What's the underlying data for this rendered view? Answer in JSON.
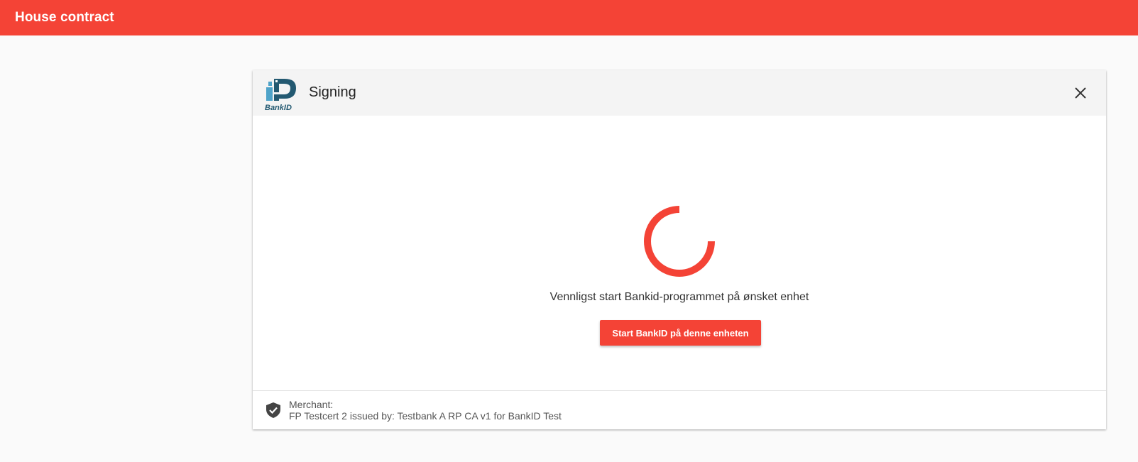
{
  "app": {
    "title": "House contract",
    "accent_color": "#f44336"
  },
  "dialog": {
    "logo": {
      "icon": "bankid-logo-icon",
      "text": "BankID"
    },
    "title": "Signing",
    "close_icon": "close-icon",
    "status_text": "Vennligst start Bankid-programmet på ønsket enhet",
    "spinner_icon": "loading-spinner-icon",
    "start_button_label": "Start BankID på denne enheten",
    "footer": {
      "icon": "verified-shield-icon",
      "merchant_label": "Merchant:",
      "merchant_value": "FP Testcert 2 issued by: Testbank A RP CA v1 for BankID Test"
    }
  }
}
